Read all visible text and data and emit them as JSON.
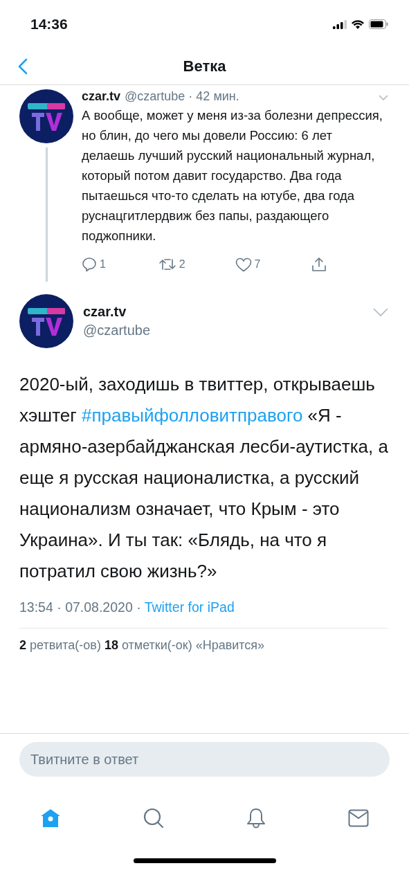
{
  "status_bar": {
    "time": "14:36"
  },
  "nav": {
    "title": "Ветка"
  },
  "parent_tweet": {
    "name": "czar.tv",
    "handle": "@czartube",
    "time": "· 42 мин.",
    "text": "А вообще, может у меня из-за болезни депрессия, но блин, до чего мы довели Россию: 6 лет делаешь лучший русский национальный журнал, который потом давит государство. Два года пытаешься что-то сделать на ютубе, два года руснацгитлердвиж без папы, раздающего поджопники.",
    "actions": [
      {
        "kind": "reply",
        "count": "1"
      },
      {
        "kind": "retweet",
        "count": "2"
      },
      {
        "kind": "like",
        "count": "7"
      },
      {
        "kind": "share"
      }
    ]
  },
  "main_tweet": {
    "name": "czar.tv",
    "handle": "@czartube",
    "text_before": "2020-ый, заходишь в твиттер, открываешь хэштег",
    "hashtag": "#правыйфолловитправого",
    "text_after": "«Я - армяно-азербайджанская лесби-аутистка, а еще я русская националистка, а русский национализм означает, что Крым - это Украина». И ты так: «Блядь, на что я потратил свою жизнь?»",
    "meta": "13:54 · 07.08.2020 ·",
    "source": "Twitter for iPad",
    "stats": "**2** ретвита(-ов)  **18** отметки(-ок) «Нравится»"
  },
  "reply_box": {
    "placeholder": "Твитните в ответ"
  },
  "tabs": [
    {
      "kind": "home",
      "selected": true
    },
    {
      "kind": "search",
      "selected": false
    },
    {
      "kind": "notifications",
      "selected": false
    },
    {
      "kind": "messages",
      "selected": false
    }
  ]
}
